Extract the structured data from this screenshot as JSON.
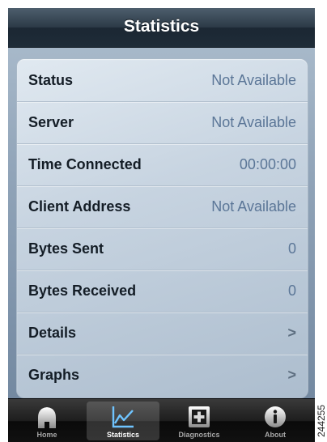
{
  "navbar": {
    "title": "Statistics"
  },
  "rows": [
    {
      "label": "Status",
      "value": "Not Available"
    },
    {
      "label": "Server",
      "value": "Not Available"
    },
    {
      "label": "Time Connected",
      "value": "00:00:00"
    },
    {
      "label": "Client Address",
      "value": "Not Available"
    },
    {
      "label": "Bytes Sent",
      "value": "0"
    },
    {
      "label": "Bytes Received",
      "value": "0"
    },
    {
      "label": "Details",
      "value": ">"
    },
    {
      "label": "Graphs",
      "value": ">"
    }
  ],
  "tabs": [
    {
      "label": "Home",
      "icon": "home-icon",
      "selected": false
    },
    {
      "label": "Statistics",
      "icon": "chart-icon",
      "selected": true
    },
    {
      "label": "Diagnostics",
      "icon": "plus-box-icon",
      "selected": false
    },
    {
      "label": "About",
      "icon": "info-icon",
      "selected": false
    }
  ],
  "figure_id": "244255",
  "colors": {
    "value_text": "#5b7697",
    "label_text": "#141d26",
    "selected_tab_label": "#ffffff",
    "tab_label": "#a6a6a6"
  }
}
